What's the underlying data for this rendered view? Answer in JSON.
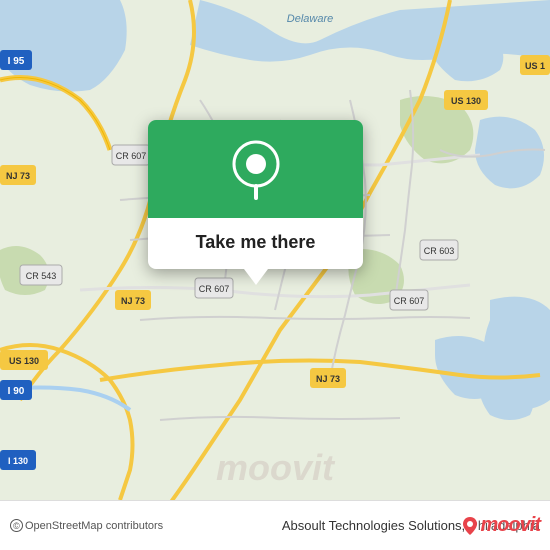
{
  "map": {
    "background_color": "#e8f0e0",
    "alt": "Map showing Philadelphia area near NJ/PA border"
  },
  "popup": {
    "label": "Take me there",
    "green_color": "#2eaa5e",
    "pin_color": "white"
  },
  "bottom_bar": {
    "copyright": "© OpenStreetMap contributors",
    "company_name": "Absoult Technologies Solutions,",
    "city": "Philadelphia",
    "logo": "moovit"
  },
  "road_labels": {
    "i95": "I 95",
    "nj73_top": "NJ 73",
    "cr607_left": "CR 607",
    "cr607_mid": "CR 607",
    "cr607_bot": "CR 607",
    "nj73_bot": "NJ 73",
    "us130_top": "US 130",
    "us130_bot": "US 130",
    "cr543": "CR 543",
    "cr603": "CR 603",
    "i90": "I 90",
    "i130": "I 130",
    "us1": "US 1",
    "delaware": "Delaware"
  }
}
